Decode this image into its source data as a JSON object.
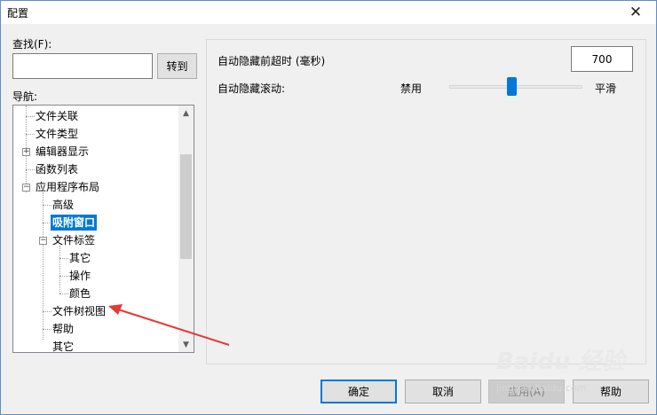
{
  "window": {
    "title": "配置",
    "close_label": "✕"
  },
  "left": {
    "search_label": "查找(F):",
    "search_value": "",
    "goto_label": "转到",
    "nav_label": "导航:",
    "tree": [
      {
        "label": "文件关联",
        "selected": false
      },
      {
        "label": "文件类型",
        "selected": false
      },
      {
        "label": "编辑器显示",
        "expander": "+",
        "selected": false
      },
      {
        "label": "函数列表",
        "selected": false
      },
      {
        "label": "应用程序布局",
        "expander": "−",
        "selected": false
      },
      {
        "label": "高级",
        "selected": false
      },
      {
        "label": "吸附窗口",
        "selected": true
      },
      {
        "label": "文件标签",
        "expander": "−",
        "selected": false
      },
      {
        "label": "其它",
        "selected": false
      },
      {
        "label": "操作",
        "selected": false
      },
      {
        "label": "颜色",
        "selected": false
      },
      {
        "label": "文件树视图",
        "selected": false
      },
      {
        "label": "帮助",
        "selected": false
      },
      {
        "label": "其它",
        "selected": false
      }
    ]
  },
  "settings": {
    "timeout_label": "自动隐藏前超时 (毫秒)",
    "timeout_value": "700",
    "scroll_label": "自动隐藏滚动:",
    "slider_min_label": "禁用",
    "slider_max_label": "平滑",
    "slider_level": 0.47
  },
  "buttons": {
    "ok": "确定",
    "cancel": "取消",
    "apply": "应用(A)",
    "help": "帮助"
  },
  "watermark": {
    "logo": "Baidu 经验",
    "sub": "jingyan.baidu.com"
  },
  "colors": {
    "selection": "#0078d7",
    "annotation_arrow": "#e53935"
  }
}
